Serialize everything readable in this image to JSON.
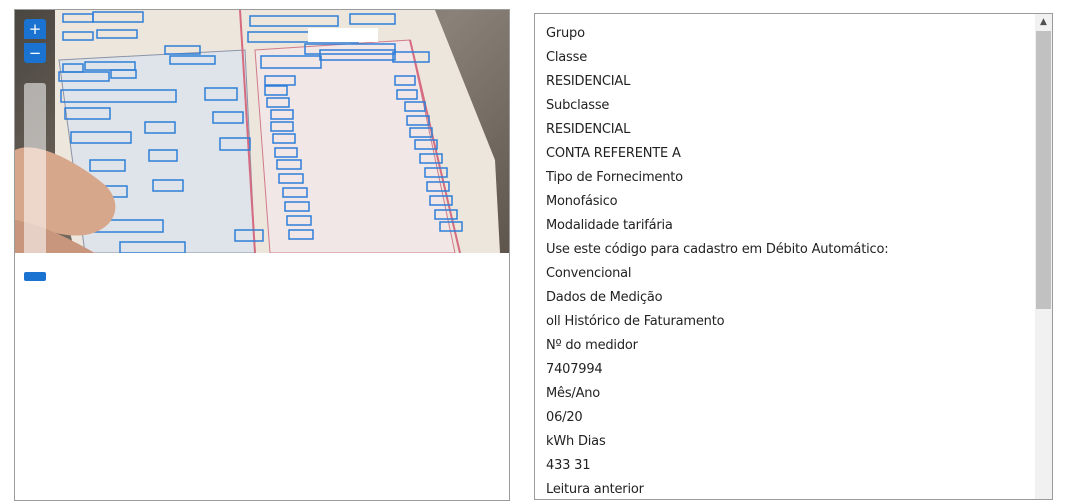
{
  "viewer": {
    "zoom_in_label": "+",
    "zoom_out_label": "−"
  },
  "text_panel": {
    "lines": [
      "Grupo",
      "Classe",
      "RESIDENCIAL",
      "Subclasse",
      "RESIDENCIAL",
      "CONTA REFERENTE A",
      "Tipo de Fornecimento",
      "Monofásico",
      "Modalidade tarifária",
      "Use este código para cadastro em Débito Automático:",
      "Convencional",
      "Dados de Medição",
      "oll Histórico de Faturamento",
      "Nº do medidor",
      "7407994",
      "Mês/Ano",
      "06/20",
      "kWh Dias",
      "433 31",
      "Leitura anterior"
    ]
  },
  "scrollbar": {
    "up_arrow_icon": "chevron-up-icon"
  }
}
